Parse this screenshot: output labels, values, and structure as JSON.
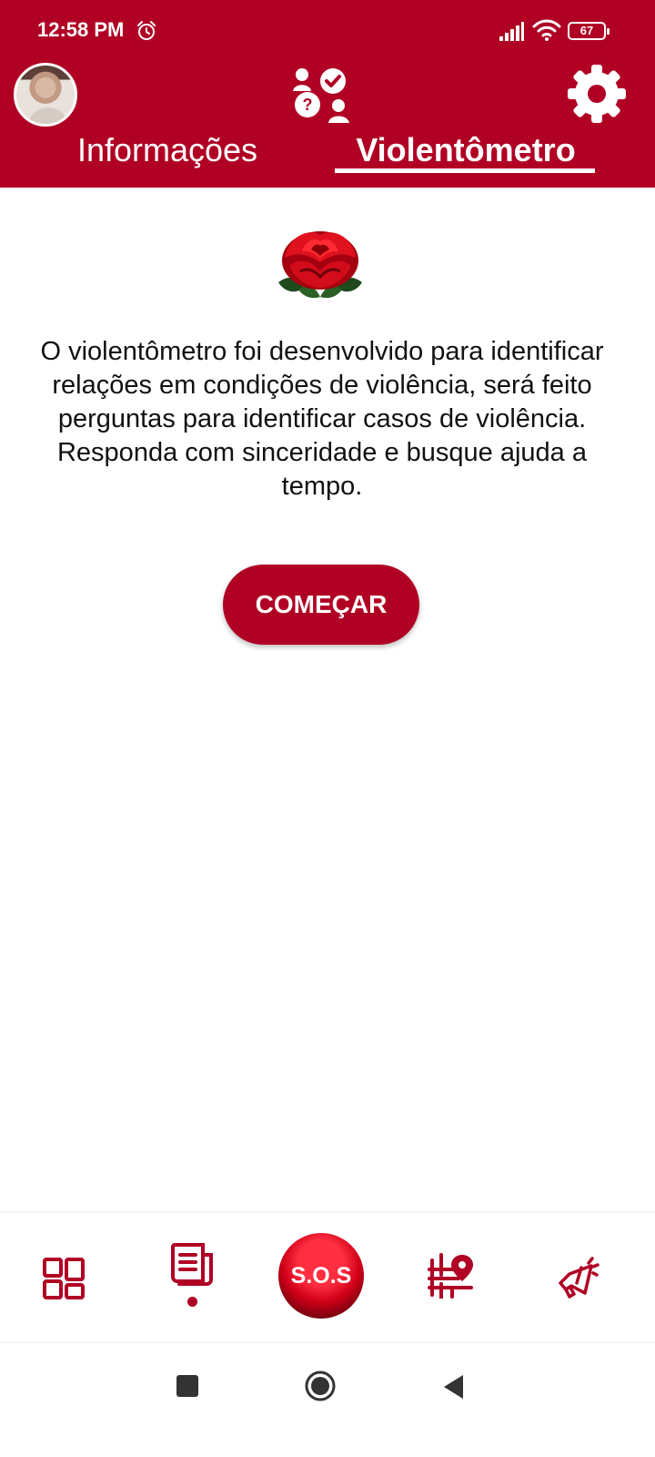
{
  "status_bar": {
    "time": "12:58 PM",
    "battery": "67",
    "icons": [
      "alarm-icon",
      "signal-icon",
      "wifi-icon",
      "battery-icon"
    ]
  },
  "header": {
    "avatar": "avatar",
    "center_icon": "people-question-check-icon",
    "settings_icon": "gear-icon",
    "tabs": [
      {
        "label": "Informações",
        "active": false
      },
      {
        "label": "Violentômetro",
        "active": true
      }
    ]
  },
  "main": {
    "logo": "rose-icon",
    "description": "O violentômetro foi desenvolvido para identificar relações em condições de violência, será feito perguntas para identificar casos de violência. Responda com sinceridade e busque ajuda a tempo.",
    "start_button_label": "COMEÇAR"
  },
  "bottom_nav": {
    "items": [
      {
        "icon": "dashboard-icon"
      },
      {
        "icon": "newspaper-icon",
        "active": true
      },
      {
        "label": "S.O.S"
      },
      {
        "icon": "map-location-icon"
      },
      {
        "icon": "megaphone-icon"
      }
    ]
  },
  "colors": {
    "primary": "#b00024",
    "background": "#ffffff",
    "text": "#111111"
  }
}
